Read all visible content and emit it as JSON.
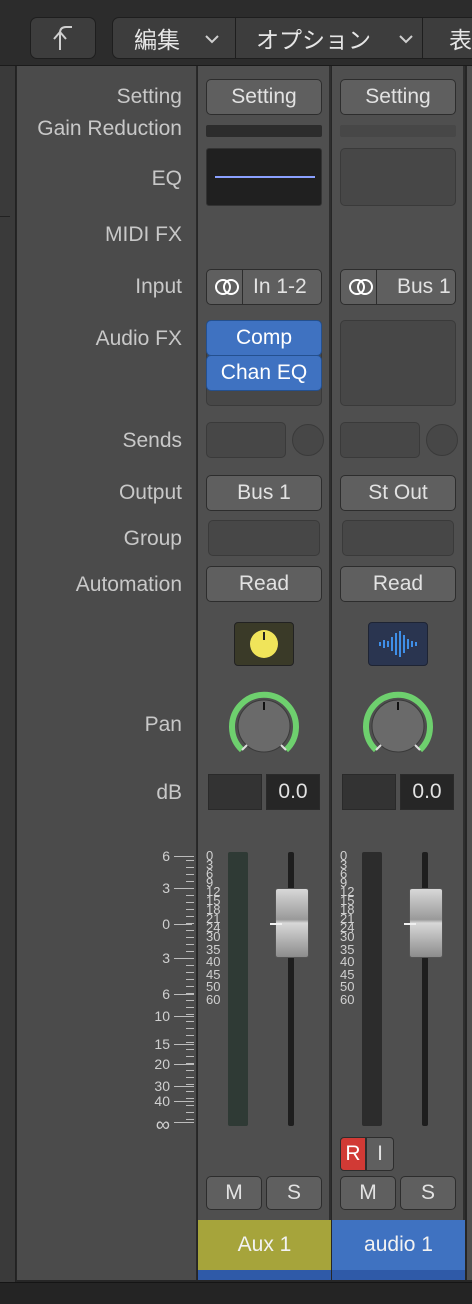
{
  "toolbar": {
    "back_icon": "back-arrow-icon",
    "edit_label": "編集",
    "options_label": "オプション",
    "view_label": "表"
  },
  "labels": {
    "setting": "Setting",
    "gain_reduction": "Gain Reduction",
    "eq": "EQ",
    "midi_fx": "MIDI FX",
    "input": "Input",
    "audio_fx": "Audio FX",
    "sends": "Sends",
    "output": "Output",
    "group": "Group",
    "automation": "Automation",
    "pan": "Pan",
    "db": "dB"
  },
  "left_scale": [
    "6",
    "3",
    "0",
    "3",
    "6",
    "10",
    "15",
    "20",
    "30",
    "40",
    "∞"
  ],
  "channel_scale": [
    "0",
    "3",
    "6",
    "9",
    "12",
    "15",
    "18",
    "21",
    "24",
    "30",
    "35",
    "40",
    "45",
    "50",
    "60"
  ],
  "channels": [
    {
      "setting": "Setting",
      "input": "In 1-2",
      "audio_fx": [
        "Comp",
        "Chan EQ"
      ],
      "output": "Bus 1",
      "automation": "Read",
      "db_value": "0.0",
      "mute": "M",
      "solo": "S",
      "name": "Aux 1",
      "name_color": "#a6a43b",
      "icon": "knob-icon",
      "icon_color": "#f0e45a"
    },
    {
      "setting": "Setting",
      "input": "Bus 1",
      "audio_fx": [],
      "output": "St Out",
      "automation": "Read",
      "db_value": "0.0",
      "record": "R",
      "input_monitor": "I",
      "mute": "M",
      "solo": "S",
      "name": "audio 1",
      "name_color": "#3f72c1",
      "icon": "waveform-icon",
      "icon_color": "#3f8fe8"
    }
  ],
  "colors": {
    "pan_ring": "#6ed06e",
    "fx_blue": "#3f72c1",
    "record_red": "#d13a35"
  }
}
